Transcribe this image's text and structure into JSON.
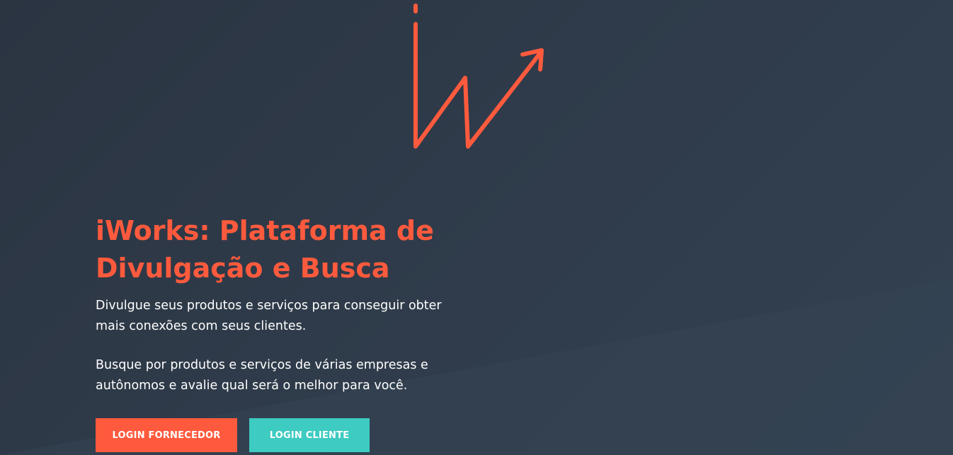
{
  "brand": {
    "logo_icon": "iworks-arrow-logo-icon",
    "accent_color": "#ff5a3d",
    "secondary_color": "#3ecbc1",
    "background_color": "#2f3b4a"
  },
  "hero": {
    "title_line1": "iWorks: Plataforma de",
    "title_line2": "Divulgação e Busca",
    "paragraph1": "Divulgue seus produtos e serviços para conseguir obter mais conexões com seus clientes.",
    "paragraph2": "Busque por produtos e serviços de várias empresas e autônomos e avalie qual será o melhor para você."
  },
  "actions": {
    "login_fornecedor": "LOGIN FORNECEDOR",
    "login_cliente": "LOGIN CLIENTE"
  }
}
